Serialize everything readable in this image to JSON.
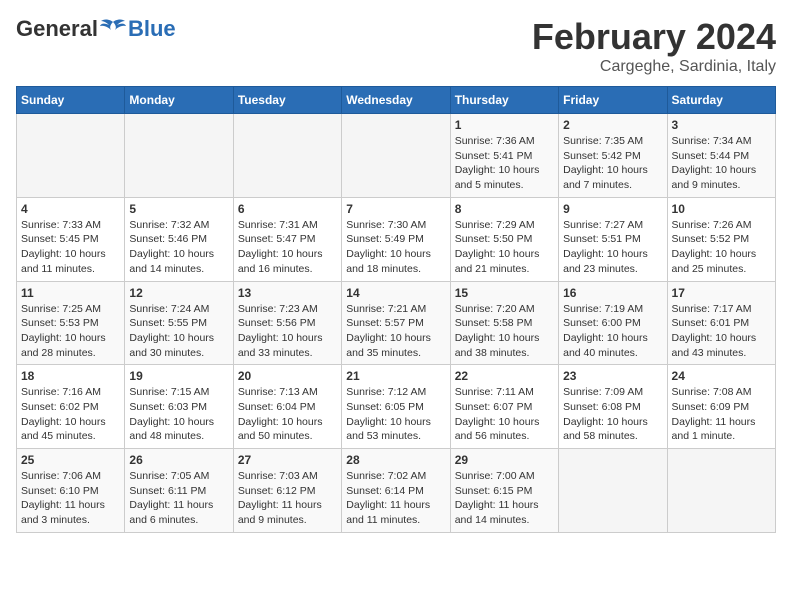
{
  "header": {
    "logo_general": "General",
    "logo_blue": "Blue",
    "title": "February 2024",
    "subtitle": "Cargeghe, Sardinia, Italy"
  },
  "weekdays": [
    "Sunday",
    "Monday",
    "Tuesday",
    "Wednesday",
    "Thursday",
    "Friday",
    "Saturday"
  ],
  "weeks": [
    [
      {
        "day": "",
        "info": ""
      },
      {
        "day": "",
        "info": ""
      },
      {
        "day": "",
        "info": ""
      },
      {
        "day": "",
        "info": ""
      },
      {
        "day": "1",
        "info": "Sunrise: 7:36 AM\nSunset: 5:41 PM\nDaylight: 10 hours\nand 5 minutes."
      },
      {
        "day": "2",
        "info": "Sunrise: 7:35 AM\nSunset: 5:42 PM\nDaylight: 10 hours\nand 7 minutes."
      },
      {
        "day": "3",
        "info": "Sunrise: 7:34 AM\nSunset: 5:44 PM\nDaylight: 10 hours\nand 9 minutes."
      }
    ],
    [
      {
        "day": "4",
        "info": "Sunrise: 7:33 AM\nSunset: 5:45 PM\nDaylight: 10 hours\nand 11 minutes."
      },
      {
        "day": "5",
        "info": "Sunrise: 7:32 AM\nSunset: 5:46 PM\nDaylight: 10 hours\nand 14 minutes."
      },
      {
        "day": "6",
        "info": "Sunrise: 7:31 AM\nSunset: 5:47 PM\nDaylight: 10 hours\nand 16 minutes."
      },
      {
        "day": "7",
        "info": "Sunrise: 7:30 AM\nSunset: 5:49 PM\nDaylight: 10 hours\nand 18 minutes."
      },
      {
        "day": "8",
        "info": "Sunrise: 7:29 AM\nSunset: 5:50 PM\nDaylight: 10 hours\nand 21 minutes."
      },
      {
        "day": "9",
        "info": "Sunrise: 7:27 AM\nSunset: 5:51 PM\nDaylight: 10 hours\nand 23 minutes."
      },
      {
        "day": "10",
        "info": "Sunrise: 7:26 AM\nSunset: 5:52 PM\nDaylight: 10 hours\nand 25 minutes."
      }
    ],
    [
      {
        "day": "11",
        "info": "Sunrise: 7:25 AM\nSunset: 5:53 PM\nDaylight: 10 hours\nand 28 minutes."
      },
      {
        "day": "12",
        "info": "Sunrise: 7:24 AM\nSunset: 5:55 PM\nDaylight: 10 hours\nand 30 minutes."
      },
      {
        "day": "13",
        "info": "Sunrise: 7:23 AM\nSunset: 5:56 PM\nDaylight: 10 hours\nand 33 minutes."
      },
      {
        "day": "14",
        "info": "Sunrise: 7:21 AM\nSunset: 5:57 PM\nDaylight: 10 hours\nand 35 minutes."
      },
      {
        "day": "15",
        "info": "Sunrise: 7:20 AM\nSunset: 5:58 PM\nDaylight: 10 hours\nand 38 minutes."
      },
      {
        "day": "16",
        "info": "Sunrise: 7:19 AM\nSunset: 6:00 PM\nDaylight: 10 hours\nand 40 minutes."
      },
      {
        "day": "17",
        "info": "Sunrise: 7:17 AM\nSunset: 6:01 PM\nDaylight: 10 hours\nand 43 minutes."
      }
    ],
    [
      {
        "day": "18",
        "info": "Sunrise: 7:16 AM\nSunset: 6:02 PM\nDaylight: 10 hours\nand 45 minutes."
      },
      {
        "day": "19",
        "info": "Sunrise: 7:15 AM\nSunset: 6:03 PM\nDaylight: 10 hours\nand 48 minutes."
      },
      {
        "day": "20",
        "info": "Sunrise: 7:13 AM\nSunset: 6:04 PM\nDaylight: 10 hours\nand 50 minutes."
      },
      {
        "day": "21",
        "info": "Sunrise: 7:12 AM\nSunset: 6:05 PM\nDaylight: 10 hours\nand 53 minutes."
      },
      {
        "day": "22",
        "info": "Sunrise: 7:11 AM\nSunset: 6:07 PM\nDaylight: 10 hours\nand 56 minutes."
      },
      {
        "day": "23",
        "info": "Sunrise: 7:09 AM\nSunset: 6:08 PM\nDaylight: 10 hours\nand 58 minutes."
      },
      {
        "day": "24",
        "info": "Sunrise: 7:08 AM\nSunset: 6:09 PM\nDaylight: 11 hours\nand 1 minute."
      }
    ],
    [
      {
        "day": "25",
        "info": "Sunrise: 7:06 AM\nSunset: 6:10 PM\nDaylight: 11 hours\nand 3 minutes."
      },
      {
        "day": "26",
        "info": "Sunrise: 7:05 AM\nSunset: 6:11 PM\nDaylight: 11 hours\nand 6 minutes."
      },
      {
        "day": "27",
        "info": "Sunrise: 7:03 AM\nSunset: 6:12 PM\nDaylight: 11 hours\nand 9 minutes."
      },
      {
        "day": "28",
        "info": "Sunrise: 7:02 AM\nSunset: 6:14 PM\nDaylight: 11 hours\nand 11 minutes."
      },
      {
        "day": "29",
        "info": "Sunrise: 7:00 AM\nSunset: 6:15 PM\nDaylight: 11 hours\nand 14 minutes."
      },
      {
        "day": "",
        "info": ""
      },
      {
        "day": "",
        "info": ""
      }
    ]
  ]
}
